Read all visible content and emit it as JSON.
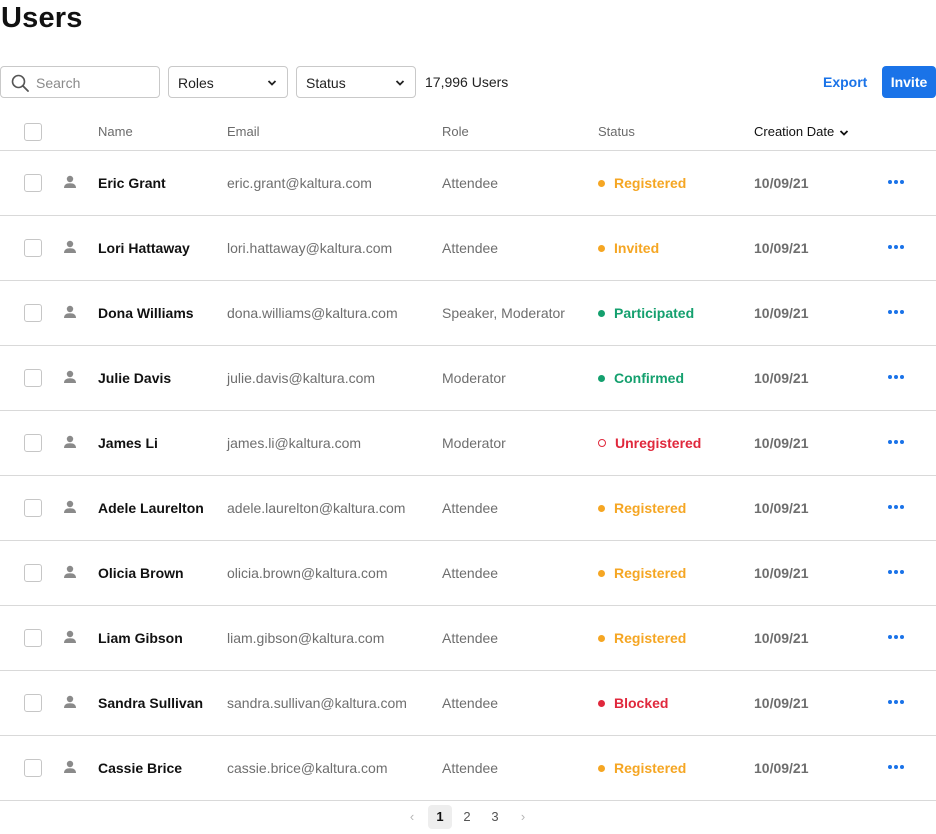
{
  "page": {
    "title": "Users"
  },
  "toolbar": {
    "search_placeholder": "Search",
    "roles_label": "Roles",
    "status_label": "Status",
    "user_count": "17,996 Users",
    "export_label": "Export",
    "invite_label": "Invite"
  },
  "table": {
    "columns": {
      "name": "Name",
      "email": "Email",
      "role": "Role",
      "status": "Status",
      "creation_date": "Creation Date"
    },
    "sorted_by": "Creation Date",
    "rows": [
      {
        "name": "Eric Grant",
        "email": "eric.grant@kaltura.com",
        "role": "Attendee",
        "status": "Registered",
        "status_color": "#f5a623",
        "status_style": "solid",
        "date": "10/09/21"
      },
      {
        "name": "Lori Hattaway",
        "email": "lori.hattaway@kaltura.com",
        "role": "Attendee",
        "status": "Invited",
        "status_color": "#f5a623",
        "status_style": "solid",
        "date": "10/09/21"
      },
      {
        "name": "Dona Williams",
        "email": "dona.williams@kaltura.com",
        "role": "Speaker, Moderator",
        "status": "Participated",
        "status_color": "#14a06e",
        "status_style": "solid",
        "date": "10/09/21"
      },
      {
        "name": "Julie Davis",
        "email": "julie.davis@kaltura.com",
        "role": "Moderator",
        "status": "Confirmed",
        "status_color": "#14a06e",
        "status_style": "solid",
        "date": "10/09/21"
      },
      {
        "name": "James Li",
        "email": "james.li@kaltura.com",
        "role": "Moderator",
        "status": "Unregistered",
        "status_color": "#e0283c",
        "status_style": "hollow",
        "date": "10/09/21"
      },
      {
        "name": "Adele Laurelton",
        "email": "adele.laurelton@kaltura.com",
        "role": "Attendee",
        "status": "Registered",
        "status_color": "#f5a623",
        "status_style": "solid",
        "date": "10/09/21"
      },
      {
        "name": "Olicia Brown",
        "email": "olicia.brown@kaltura.com",
        "role": "Attendee",
        "status": "Registered",
        "status_color": "#f5a623",
        "status_style": "solid",
        "date": "10/09/21"
      },
      {
        "name": "Liam Gibson",
        "email": "liam.gibson@kaltura.com",
        "role": "Attendee",
        "status": "Registered",
        "status_color": "#f5a623",
        "status_style": "solid",
        "date": "10/09/21"
      },
      {
        "name": "Sandra Sullivan",
        "email": "sandra.sullivan@kaltura.com",
        "role": "Attendee",
        "status": "Blocked",
        "status_color": "#e0283c",
        "status_style": "solid",
        "date": "10/09/21"
      },
      {
        "name": "Cassie Brice",
        "email": "cassie.brice@kaltura.com",
        "role": "Attendee",
        "status": "Registered",
        "status_color": "#f5a623",
        "status_style": "solid",
        "date": "10/09/21"
      }
    ]
  },
  "pagination": {
    "pages": [
      "1",
      "2",
      "3"
    ],
    "current": "1",
    "prev_glyph": "‹",
    "next_glyph": "›"
  },
  "colors": {
    "accent": "#1a73e8",
    "registered": "#f5a623",
    "positive": "#14a06e",
    "negative": "#e0283c"
  },
  "icons": {
    "search": "search-icon",
    "chevron": "chevron-down-icon",
    "person": "person-icon",
    "more": "more-horizontal-icon"
  }
}
